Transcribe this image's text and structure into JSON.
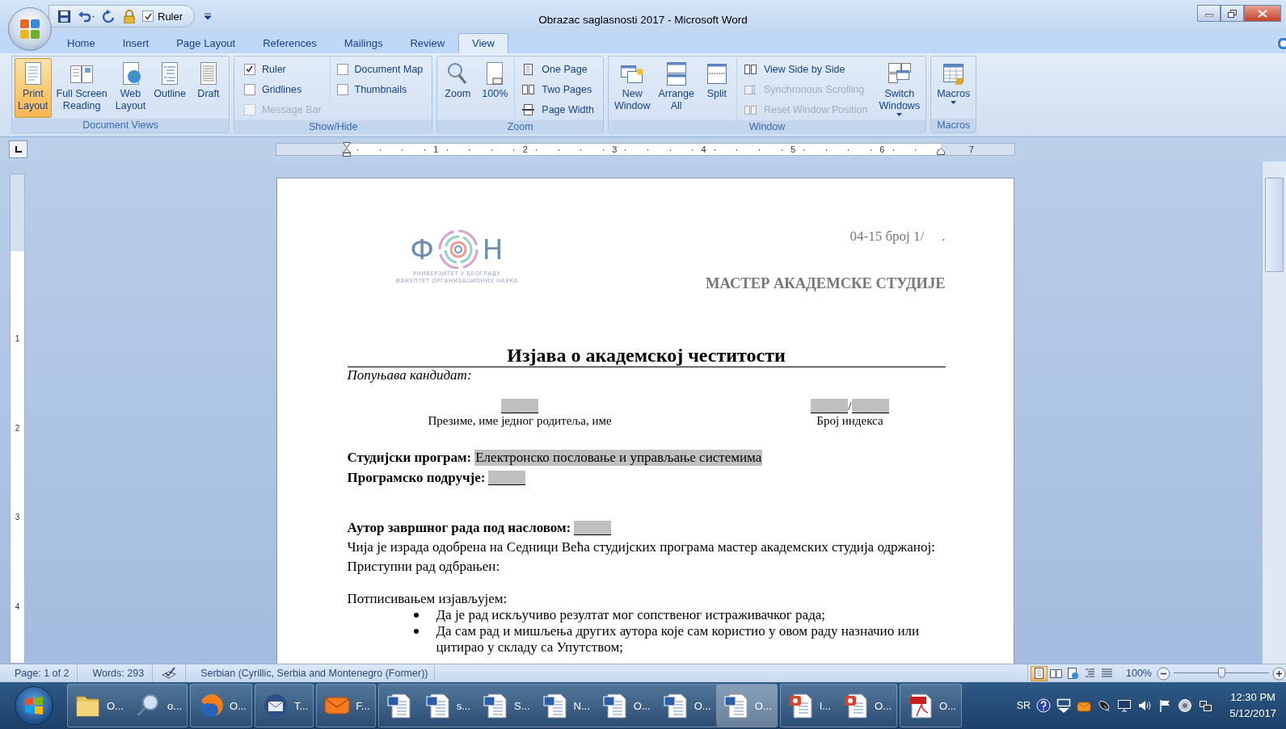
{
  "title_bar": {
    "quick_access": [
      {
        "kind": "save"
      },
      {
        "kind": "undo"
      },
      {
        "kind": "redo"
      },
      {
        "kind": "lock"
      }
    ],
    "ruler_toggle": {
      "label": "Ruler",
      "checked": true
    },
    "title": "Obrazac saglasnosti 2017 - Microsoft Word"
  },
  "tabs": [
    {
      "label": "Home",
      "selected": false
    },
    {
      "label": "Insert",
      "selected": false
    },
    {
      "label": "Page Layout",
      "selected": false
    },
    {
      "label": "References",
      "selected": false
    },
    {
      "label": "Mailings",
      "selected": false
    },
    {
      "label": "Review",
      "selected": false
    },
    {
      "label": "View",
      "selected": true
    }
  ],
  "ribbon": {
    "groups": [
      {
        "label": "Document Views",
        "items": [
          {
            "kind": "large",
            "label": [
              "Print",
              "Layout"
            ],
            "selected": true,
            "dropdown": false
          },
          {
            "kind": "large",
            "label": [
              "Full Screen",
              "Reading"
            ],
            "selected": false,
            "dropdown": false
          },
          {
            "kind": "large",
            "label": [
              "Web",
              "Layout"
            ],
            "selected": false,
            "dropdown": false
          },
          {
            "kind": "large",
            "label": [
              "Outline"
            ],
            "selected": false,
            "dropdown": false
          },
          {
            "kind": "large",
            "label": [
              "Draft"
            ],
            "selected": false,
            "dropdown": false
          }
        ]
      },
      {
        "label": "Show/Hide",
        "items": [
          {
            "kind": "check",
            "label": "Ruler",
            "checked": true,
            "disabled": false
          },
          {
            "kind": "check",
            "label": "Gridlines",
            "checked": false,
            "disabled": false
          },
          {
            "kind": "check",
            "label": "Message Bar",
            "checked": false,
            "disabled": true
          },
          {
            "kind": "check",
            "label": "Document Map",
            "checked": false,
            "disabled": false
          },
          {
            "kind": "check",
            "label": "Thumbnails",
            "checked": false,
            "disabled": false
          }
        ]
      },
      {
        "label": "Zoom",
        "items": [
          {
            "kind": "large",
            "label": [
              "Zoom"
            ],
            "selected": false,
            "dropdown": false
          },
          {
            "kind": "large",
            "label": [
              "100%"
            ],
            "selected": false,
            "dropdown": false
          },
          {
            "kind": "small",
            "label": "One Page",
            "disabled": false
          },
          {
            "kind": "small",
            "label": "Two Pages",
            "disabled": false
          },
          {
            "kind": "small",
            "label": "Page Width",
            "disabled": false
          }
        ]
      },
      {
        "label": "Window",
        "items": [
          {
            "kind": "large",
            "label": [
              "New",
              "Window"
            ],
            "selected": false,
            "dropdown": false
          },
          {
            "kind": "large",
            "label": [
              "Arrange",
              "All"
            ],
            "selected": false,
            "dropdown": false
          },
          {
            "kind": "large",
            "label": [
              "Split"
            ],
            "selected": false,
            "dropdown": false
          },
          {
            "kind": "small",
            "label": "View Side by Side",
            "disabled": false
          },
          {
            "kind": "small",
            "label": "Synchronous Scrolling",
            "disabled": true
          },
          {
            "kind": "small",
            "label": "Reset Window Position",
            "disabled": true
          },
          {
            "kind": "large",
            "label": [
              "Switch",
              "Windows"
            ],
            "selected": false,
            "dropdown": true
          }
        ]
      },
      {
        "label": "Macros",
        "items": [
          {
            "kind": "large",
            "label": [
              "Macros"
            ],
            "selected": false,
            "dropdown": true
          }
        ]
      }
    ]
  },
  "ruler": {
    "numbers": [
      "1",
      "2",
      "3",
      "4",
      "5",
      "6",
      "7"
    ]
  },
  "vertical_ruler": {
    "numbers": [
      "1",
      "2",
      "3",
      "4"
    ]
  },
  "document": {
    "reference": "04-15 број 1/",
    "reference_end": ".",
    "logo": {
      "letters": [
        "Ф",
        "Н"
      ],
      "lines": [
        "УНИВЕРЗИТЕТ У БЕОГРАДУ",
        "ФАКУЛТЕТ ОРГАНИЗАЦИОНИХ НАУКА"
      ]
    },
    "heading": "МАСТЕР АКАДЕМСКЕ СТУДИЈЕ",
    "title": "Изјава о академској честитости",
    "subtitle": "Попуњава кандидат:",
    "signature_fields": [
      {
        "caption": "Презиме, име једног родитеља, име",
        "parts": [
          {
            "kind": "blank"
          }
        ]
      },
      {
        "caption": "Број индекса",
        "parts": [
          {
            "kind": "blank"
          },
          {
            "kind": "text",
            "text": "/"
          },
          {
            "kind": "blank"
          }
        ]
      }
    ],
    "program_fields": [
      {
        "label": "Студијски програм:",
        "value": "Електронско пословање и управљање системима"
      },
      {
        "label": "Програмско подручје:"
      }
    ],
    "author_field": {
      "label": "Аутор завршног рада под насловом:"
    },
    "paragraphs": [
      "Чија је израда одобрена на Седници Већа студијских програма мастер академских студија одржаној:",
      "Приступни рад одбрањен:"
    ],
    "statement": {
      "intro": "Потписивањем изјављујем:",
      "bullets": [
        "Да је рад искључиво резултат мог сопственог истраживачког рада;",
        "Да сам рад и мишљења других аутора које сам користио у овом раду назначио или цитирао у складу са Упутством;"
      ]
    }
  },
  "status_bar": {
    "page": "Page: 1 of 2",
    "words": "Words: 293",
    "language": "Serbian (Cyrillic, Serbia and Montenegro (Former))",
    "views": [
      {
        "kind": "print",
        "selected": true
      },
      {
        "kind": "reading",
        "selected": false
      },
      {
        "kind": "web",
        "selected": false
      },
      {
        "kind": "outline",
        "selected": false
      },
      {
        "kind": "draft",
        "selected": false
      }
    ],
    "zoom": "100%",
    "zoom_slider": {
      "level": 0.5
    }
  },
  "taskbar": {
    "groups": [
      {
        "items": [
          {
            "kind": "folder",
            "label": "O...",
            "selected": false
          },
          {
            "kind": "search",
            "label": "o...",
            "selected": false
          }
        ]
      },
      {
        "items": [
          {
            "kind": "browser",
            "label": "O...",
            "selected": false
          }
        ]
      },
      {
        "items": [
          {
            "kind": "mail-client",
            "label": "T...",
            "selected": false
          }
        ]
      },
      {
        "items": [
          {
            "kind": "envelope",
            "label": "F...",
            "selected": false
          }
        ]
      },
      {
        "items": [
          {
            "kind": "word",
            "selected": false
          },
          {
            "kind": "word",
            "label": "s...",
            "selected": false
          },
          {
            "kind": "word",
            "label": "S...",
            "selected": false
          },
          {
            "kind": "word",
            "label": "N...",
            "selected": false
          },
          {
            "kind": "word",
            "label": "O...",
            "selected": false
          },
          {
            "kind": "word",
            "label": "O...",
            "selected": false
          },
          {
            "kind": "word",
            "label": "O...",
            "selected": true
          }
        ]
      },
      {
        "items": [
          {
            "kind": "slides",
            "label": "I...",
            "selected": false
          },
          {
            "kind": "slides",
            "label": "O...",
            "selected": false
          }
        ]
      },
      {
        "items": [
          {
            "kind": "pdf",
            "label": "O...",
            "selected": false
          }
        ]
      }
    ],
    "tray": {
      "language": "SR",
      "icons": [
        {
          "kind": "help"
        },
        {
          "kind": "arrows"
        },
        {
          "kind": "mail"
        },
        {
          "kind": "satellite"
        },
        {
          "kind": "monitor"
        },
        {
          "kind": "volume"
        },
        {
          "kind": "flag"
        },
        {
          "kind": "disc"
        },
        {
          "kind": "network"
        }
      ],
      "time": "12:30 PM",
      "date": "5/12/2017"
    }
  }
}
